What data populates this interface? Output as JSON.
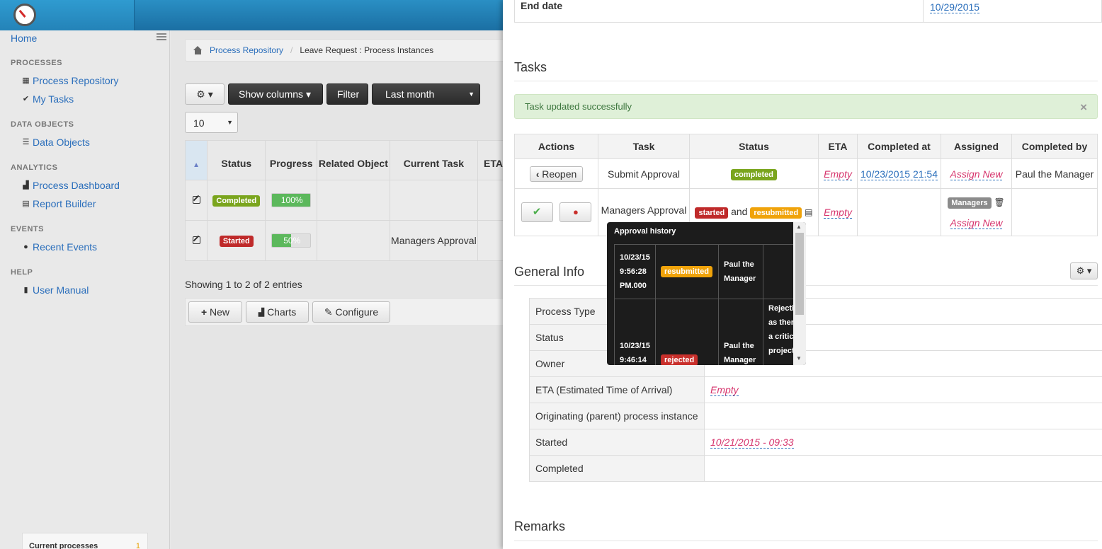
{
  "sidebar": {
    "home": "Home",
    "sections": [
      {
        "title": "PROCESSES",
        "items": [
          {
            "label": "Process Repository",
            "icon": "grid-icon"
          },
          {
            "label": "My Tasks",
            "icon": "check-circle-icon"
          }
        ]
      },
      {
        "title": "DATA OBJECTS",
        "items": [
          {
            "label": "Data Objects",
            "icon": "list-icon"
          }
        ]
      },
      {
        "title": "ANALYTICS",
        "items": [
          {
            "label": "Process Dashboard",
            "icon": "bar-chart-icon"
          },
          {
            "label": "Report Builder",
            "icon": "report-icon"
          }
        ]
      },
      {
        "title": "EVENTS",
        "items": [
          {
            "label": "Recent Events",
            "icon": "globe-icon"
          }
        ]
      },
      {
        "title": "HELP",
        "items": [
          {
            "label": "User Manual",
            "icon": "book-icon"
          }
        ]
      }
    ],
    "current_processes": {
      "label": "Current processes",
      "count": "1"
    }
  },
  "breadcrumb": {
    "link": "Process Repository",
    "current": "Leave Request : Process Instances"
  },
  "toolbar": {
    "show_columns": "Show columns",
    "filter": "Filter",
    "period": "Last month"
  },
  "page_size": "10",
  "grid": {
    "headers": [
      "Status",
      "Progress",
      "Related Object",
      "Current Task",
      "ETA"
    ],
    "rows": [
      {
        "status": "Completed",
        "progress": 100,
        "progress_label": "100%",
        "related": "",
        "current_task": "",
        "eta": ""
      },
      {
        "status": "Started",
        "progress": 50,
        "progress_label": "50%",
        "related": "",
        "current_task": "Managers Approval",
        "eta": ""
      }
    ]
  },
  "showing": "Showing 1 to 2 of 2 entries",
  "bottom_buttons": {
    "new": "New",
    "charts": "Charts",
    "configure": "Configure"
  },
  "panel": {
    "end_date_label": "End date",
    "end_date_value": "10/29/2015",
    "tasks_title": "Tasks",
    "alert": "Task updated successfully",
    "alert_close": "×",
    "task_headers": [
      "Actions",
      "Task",
      "Status",
      "ETA",
      "Completed at",
      "Assigned",
      "Completed by"
    ],
    "task_rows": [
      {
        "action": "Reopen",
        "task": "Submit Approval",
        "status": "completed",
        "eta": "Empty",
        "completed_at": "10/23/2015 21:54",
        "assigned": "Assign New",
        "completed_by": "Paul the Manager"
      },
      {
        "task": "Managers Approval",
        "status1": "started",
        "and": "and",
        "status2": "resubmitted",
        "eta": "Empty",
        "assigned_group": "Managers",
        "assigned": "Assign New"
      }
    ],
    "general_title": "General Info",
    "general": [
      {
        "key": "Process Type",
        "value": ""
      },
      {
        "key": "Status",
        "value": ""
      },
      {
        "key": "Owner",
        "value": ""
      },
      {
        "key": "ETA (Estimated Time of Arrival)",
        "value": "Empty"
      },
      {
        "key": "Originating (parent) process instance",
        "value": ""
      },
      {
        "key": "Started",
        "value": "10/21/2015 - 09:33"
      },
      {
        "key": "Completed",
        "value": ""
      }
    ],
    "remarks_title": "Remarks"
  },
  "tooltip": {
    "title": "Approval history",
    "rows": [
      {
        "time": "10/23/15 9:56:28 PM.000",
        "status": "resubmitted",
        "by": "Paul the Manager",
        "note": ""
      },
      {
        "time": "10/23/15 9:46:14",
        "status": "rejected",
        "by": "Paul the Manager",
        "note": "Rejecti as ther a critic project"
      }
    ]
  }
}
